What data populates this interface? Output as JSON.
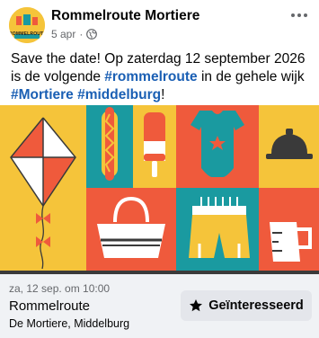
{
  "post": {
    "page_name": "Rommelroute Mortiere",
    "avatar_label": "ROMMELROUTE",
    "time": "5 apr",
    "separator": "·",
    "privacy_icon": "globe-icon",
    "more_icon": "more-dots-icon",
    "text_before": "Save the date! Op zaterdag 12 september 2026 is de volgende ",
    "hashtag1": "#rommelroute",
    "text_middle": " in de gehele wijk ",
    "hashtag2": "#Mortiere",
    "text_space": " ",
    "hashtag3": "#middelburg",
    "text_after": "!"
  },
  "event": {
    "date": "za, 12 sep. om 10:00",
    "name": "Rommelroute",
    "location": "De Mortiere, Middelburg",
    "interested_label": "Geïnteresseerd",
    "interested_icon": "star-icon"
  },
  "colors": {
    "red": "#ef5a3c",
    "yellow": "#f5c43a",
    "teal": "#1a9aa0",
    "dark": "#3a3a3a",
    "hashtag": "#1a5fb4"
  }
}
